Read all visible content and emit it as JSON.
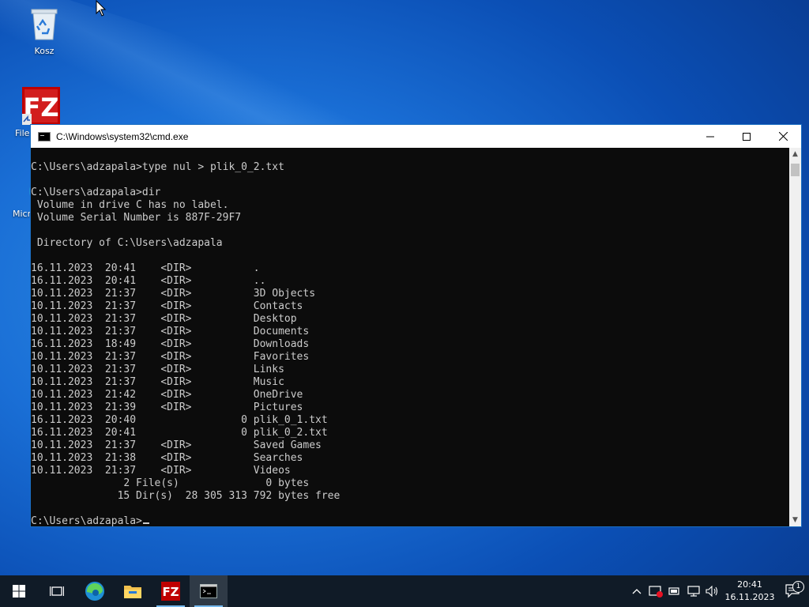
{
  "desktop": {
    "icons": [
      {
        "label": "Kosz"
      },
      {
        "label": "File"
      },
      {
        "label": "Micr"
      }
    ]
  },
  "window": {
    "title": "C:\\Windows\\system32\\cmd.exe"
  },
  "console": {
    "lines": [
      "C:\\Users\\adzapala>type nul > plik_0_2.txt",
      "",
      "C:\\Users\\adzapala>dir",
      " Volume in drive C has no label.",
      " Volume Serial Number is 887F-29F7",
      "",
      " Directory of C:\\Users\\adzapala",
      "",
      "16.11.2023  20:41    <DIR>          .",
      "16.11.2023  20:41    <DIR>          ..",
      "10.11.2023  21:37    <DIR>          3D Objects",
      "10.11.2023  21:37    <DIR>          Contacts",
      "10.11.2023  21:37    <DIR>          Desktop",
      "10.11.2023  21:37    <DIR>          Documents",
      "16.11.2023  18:49    <DIR>          Downloads",
      "10.11.2023  21:37    <DIR>          Favorites",
      "10.11.2023  21:37    <DIR>          Links",
      "10.11.2023  21:37    <DIR>          Music",
      "10.11.2023  21:42    <DIR>          OneDrive",
      "10.11.2023  21:39    <DIR>          Pictures",
      "16.11.2023  20:40                 0 plik_0_1.txt",
      "16.11.2023  20:41                 0 plik_0_2.txt",
      "10.11.2023  21:37    <DIR>          Saved Games",
      "10.11.2023  21:38    <DIR>          Searches",
      "10.11.2023  21:37    <DIR>          Videos",
      "               2 File(s)              0 bytes",
      "              15 Dir(s)  28 305 313 792 bytes free",
      ""
    ],
    "prompt": "C:\\Users\\adzapala>"
  },
  "taskbar": {
    "apps": [
      {
        "name": "task-view"
      },
      {
        "name": "edge"
      },
      {
        "name": "file-explorer"
      },
      {
        "name": "filezilla"
      },
      {
        "name": "cmd"
      }
    ],
    "clock": {
      "time": "20:41",
      "date": "16.11.2023"
    },
    "notification_count": "1"
  },
  "colors": {
    "console_bg": "#0c0c0c",
    "console_fg": "#cccccc",
    "taskbar_bg": "#101b27",
    "accent": "#76b9ed"
  }
}
